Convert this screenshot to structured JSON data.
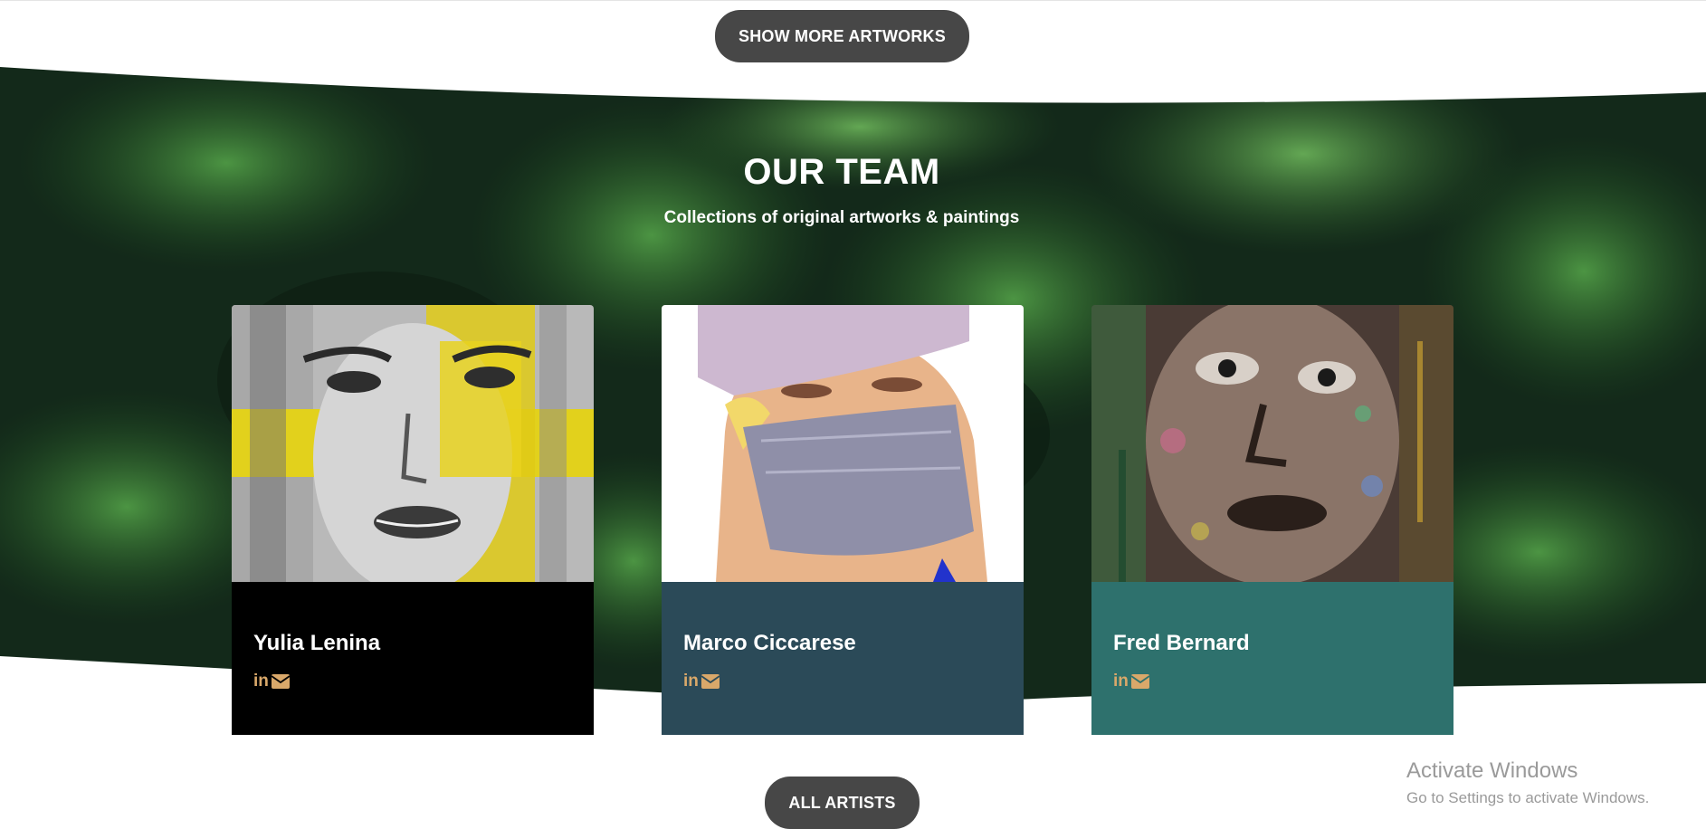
{
  "buttons": {
    "show_more": "SHOW MORE ARTWORKS",
    "all_artists": "ALL ARTISTS"
  },
  "team": {
    "title": "OUR TEAM",
    "subtitle": "Collections of original artworks & paintings",
    "members": [
      {
        "name": "Yulia Lenina",
        "info_color": "#000000"
      },
      {
        "name": "Marco Ciccarese",
        "info_color": "#2b4a58"
      },
      {
        "name": "Fred Bernard",
        "info_color": "#2e716d"
      }
    ],
    "social_icons": [
      "linkedin-icon",
      "mail-icon"
    ],
    "social_color": "#d9a86a"
  },
  "colors": {
    "button_bg": "#474747",
    "forest_dark": "#0f2613",
    "forest_green": "#2f6b2e"
  },
  "watermark": {
    "title": "Activate Windows",
    "subtitle": "Go to Settings to activate Windows."
  }
}
